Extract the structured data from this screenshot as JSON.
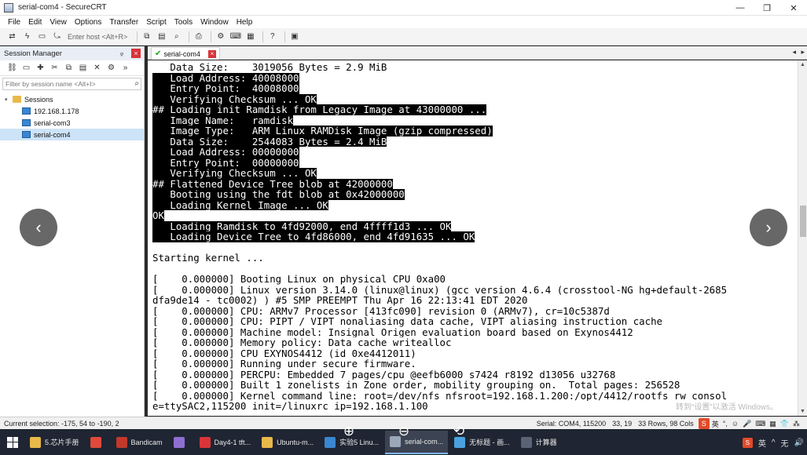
{
  "window": {
    "title": "serial-com4 - SecureCRT",
    "controls": {
      "minimize": "—",
      "maximize": "❐",
      "close": "✕"
    }
  },
  "menu": [
    "File",
    "Edit",
    "View",
    "Options",
    "Transfer",
    "Script",
    "Tools",
    "Window",
    "Help"
  ],
  "toolbar": {
    "host_placeholder": "Enter host <Alt+R>",
    "icons": [
      "quick-connect-icon",
      "lightning-icon",
      "reconnect-icon",
      "disconnect-icon",
      "copy-icon",
      "paste-icon",
      "find-icon",
      "print-icon",
      "settings-icon",
      "keymap-icon",
      "sftp-icon",
      "help-icon",
      "screen-icon"
    ]
  },
  "session_manager": {
    "title": "Session Manager",
    "pin": "ᵩ",
    "filter_placeholder": "Filter by session name <Alt+I>",
    "tree": {
      "root": "Sessions",
      "items": [
        "192.168.1.178",
        "serial-com3",
        "serial-com4"
      ],
      "selected": "serial-com4"
    }
  },
  "tabs": [
    {
      "label": "serial-com4",
      "status": "connected"
    }
  ],
  "terminal": {
    "lines": [
      {
        "t": "   Data Size:    3019056 Bytes = 2.9 MiB",
        "hl": false
      },
      {
        "t": "   Load Address: 40008000",
        "hl": true
      },
      {
        "t": "   Entry Point:  40008000",
        "hl": true
      },
      {
        "t": "   Verifying Checksum ... OK",
        "hl": true
      },
      {
        "t": "## Loading init Ramdisk from Legacy Image at 43000000 ...",
        "hl": true
      },
      {
        "t": "   Image Name:   ramdisk",
        "hl": true
      },
      {
        "t": "   Image Type:   ARM Linux RAMDisk Image (gzip compressed)",
        "hl": true
      },
      {
        "t": "   Data Size:    2544083 Bytes = 2.4 MiB",
        "hl": true
      },
      {
        "t": "   Load Address: 00000000",
        "hl": true
      },
      {
        "t": "   Entry Point:  00000000",
        "hl": true
      },
      {
        "t": "   Verifying Checksum ... OK",
        "hl": true
      },
      {
        "t": "## Flattened Device Tree blob at 42000000",
        "hl": true
      },
      {
        "t": "   Booting using the fdt blob at 0x42000000",
        "hl": true
      },
      {
        "t": "   Loading Kernel Image ... OK",
        "hl": true
      },
      {
        "t": "OK",
        "hl": true
      },
      {
        "t": "   Loading Ramdisk to 4fd92000, end 4ffff1d3 ... OK",
        "hl": true
      },
      {
        "t": "   Loading Device Tree to 4fd86000, end 4fd91635 ... OK",
        "hl": true
      },
      {
        "t": "",
        "hl": false
      },
      {
        "t": "Starting kernel ...",
        "hl": false
      },
      {
        "t": "",
        "hl": false
      },
      {
        "t": "[    0.000000] Booting Linux on physical CPU 0xa00",
        "hl": false
      },
      {
        "t": "[    0.000000] Linux version 3.14.0 (linux@linux) (gcc version 4.6.4 (crosstool-NG hg+default-2685",
        "hl": false
      },
      {
        "t": "dfa9de14 - tc0002) ) #5 SMP PREEMPT Thu Apr 16 22:13:41 EDT 2020",
        "hl": false
      },
      {
        "t": "[    0.000000] CPU: ARMv7 Processor [413fc090] revision 0 (ARMv7), cr=10c5387d",
        "hl": false
      },
      {
        "t": "[    0.000000] CPU: PIPT / VIPT nonaliasing data cache, VIPT aliasing instruction cache",
        "hl": false
      },
      {
        "t": "[    0.000000] Machine model: Insignal Origen evaluation board based on Exynos4412",
        "hl": false
      },
      {
        "t": "[    0.000000] Memory policy: Data cache writealloc",
        "hl": false
      },
      {
        "t": "[    0.000000] CPU EXYNOS4412 (id 0xe4412011)",
        "hl": false
      },
      {
        "t": "[    0.000000] Running under secure firmware.",
        "hl": false
      },
      {
        "t": "[    0.000000] PERCPU: Embedded 7 pages/cpu @eefb6000 s7424 r8192 d13056 u32768",
        "hl": false
      },
      {
        "t": "[    0.000000] Built 1 zonelists in Zone order, mobility grouping on.  Total pages: 256528",
        "hl": false
      },
      {
        "t": "[    0.000000] Kernel command line: root=/dev/nfs nfsroot=192.168.1.200:/opt/4412/rootfs rw consol",
        "hl": false
      },
      {
        "t": "e=ttySAC2,115200 init=/linuxrc ip=192.168.1.100",
        "hl": false
      }
    ]
  },
  "overlay": {
    "prev": "‹",
    "next": "›",
    "watermark": "转到“设置”以激活 Windows。"
  },
  "statusbar": {
    "current_selection": "Current selection: -175, 54 to -190, 2",
    "port": "Serial: COM4, 115200",
    "cursor": "33,  19",
    "size": "33 Rows, 98 Cols",
    "ime": [
      "英",
      "°,",
      "☺",
      "🎤",
      "⌨",
      "▦",
      "👕",
      "⁂"
    ]
  },
  "viewer_controls": {
    "zoom_in": "⊕",
    "zoom_out": "⊖",
    "rotate": "⟲"
  },
  "taskbar": {
    "tasks": [
      {
        "label": "5.芯片手册",
        "color": "#e8b84a",
        "active": false
      },
      {
        "label": "",
        "color": "#e04a3b",
        "active": false
      },
      {
        "label": "Bandicam",
        "color": "#c0392b",
        "active": false
      },
      {
        "label": "",
        "color": "#8e6fd1",
        "active": false
      },
      {
        "label": "Day4-1 tft...",
        "color": "#d9343a",
        "active": false
      },
      {
        "label": "Ubuntu-m...",
        "color": "#e8b84a",
        "active": false
      },
      {
        "label": "实验5 Linu...",
        "color": "#3a86d1",
        "active": false
      },
      {
        "label": "serial-com...",
        "color": "#9aa7b8",
        "active": true
      },
      {
        "label": "无标题 - 画...",
        "color": "#4aa3e0",
        "active": false
      },
      {
        "label": "计算器",
        "color": "#5a6375",
        "active": false
      }
    ],
    "tray": [
      "S",
      "英",
      "^",
      "无",
      "🔊"
    ]
  }
}
